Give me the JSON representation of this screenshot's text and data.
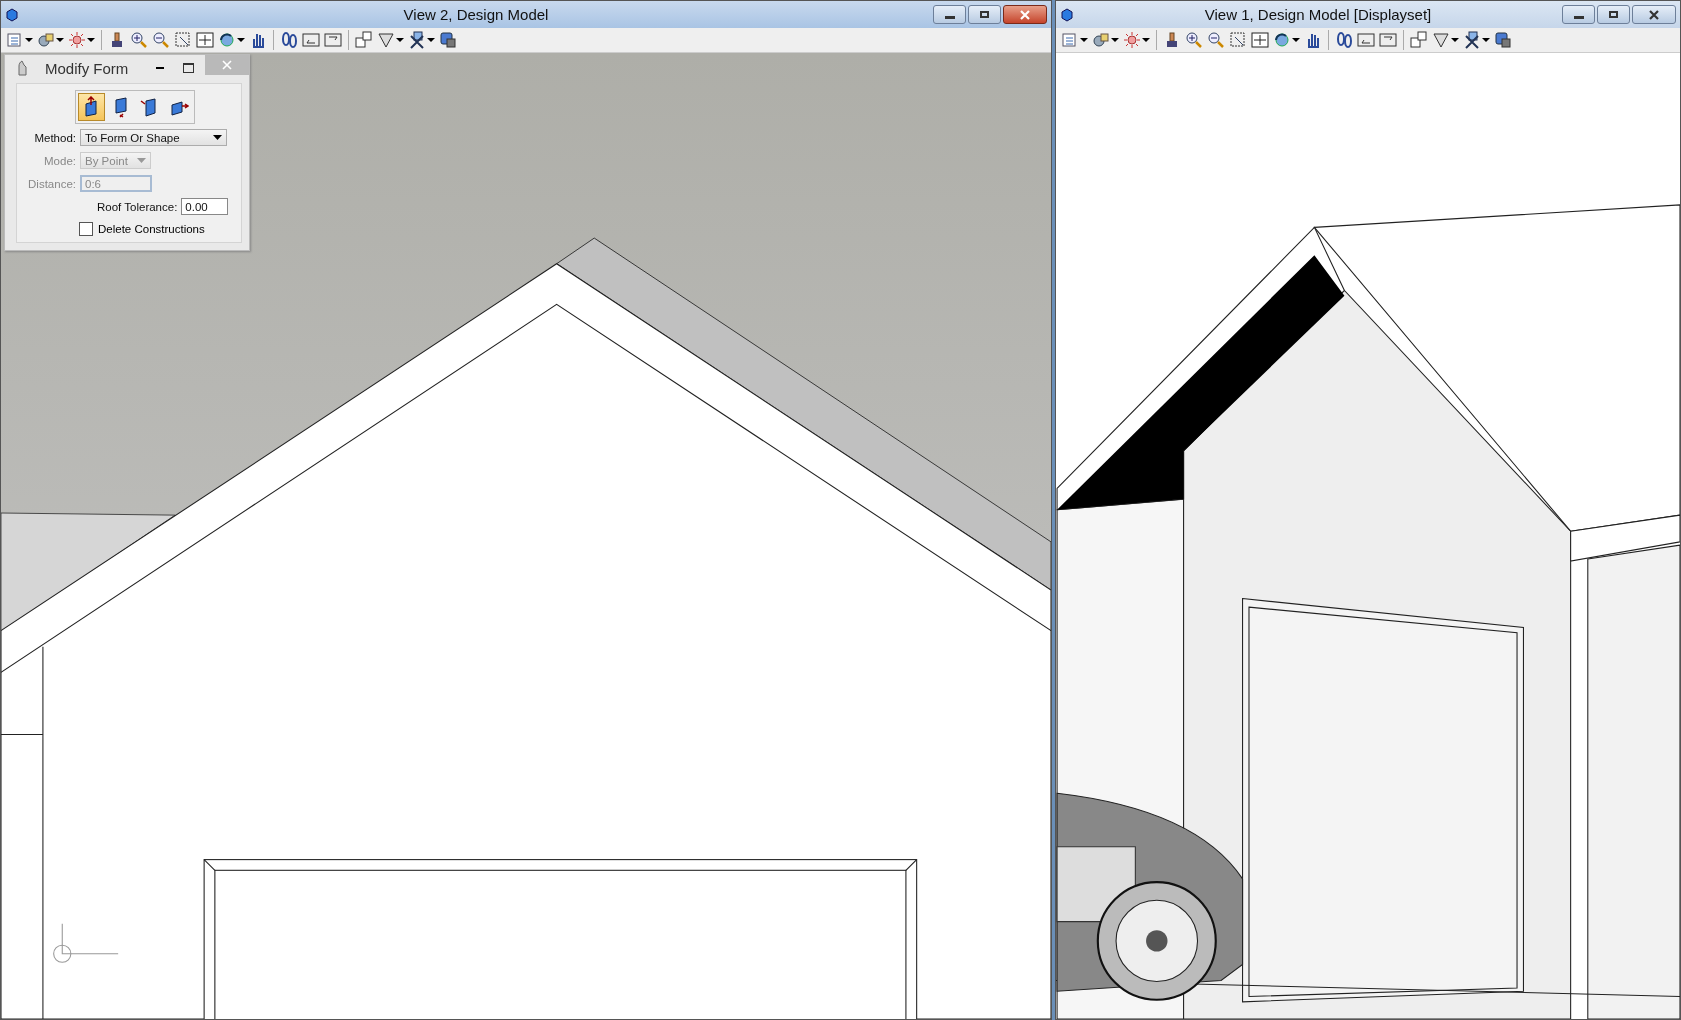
{
  "windows": [
    {
      "title": "View 2, Design Model",
      "active": true
    },
    {
      "title": "View 1, Design Model [Displayset]",
      "active": false
    }
  ],
  "dialog": {
    "title": "Modify Form",
    "tools": [
      {
        "selected": true
      },
      {
        "selected": false
      },
      {
        "selected": false
      },
      {
        "selected": false
      }
    ],
    "fields": [
      {
        "kind": "dropdown",
        "label": "Method:",
        "value": "To Form Or Shape",
        "disabled": false
      },
      {
        "kind": "dropdown",
        "label": "Mode:",
        "value": "By Point",
        "disabled": true
      },
      {
        "kind": "text",
        "label": "Distance:",
        "value": "0:6",
        "disabled": true
      },
      {
        "kind": "text",
        "label": "Roof Tolerance:",
        "value": "0.00",
        "disabled": false
      }
    ],
    "checkbox": {
      "label": "Delete Constructions",
      "checked": false
    }
  }
}
